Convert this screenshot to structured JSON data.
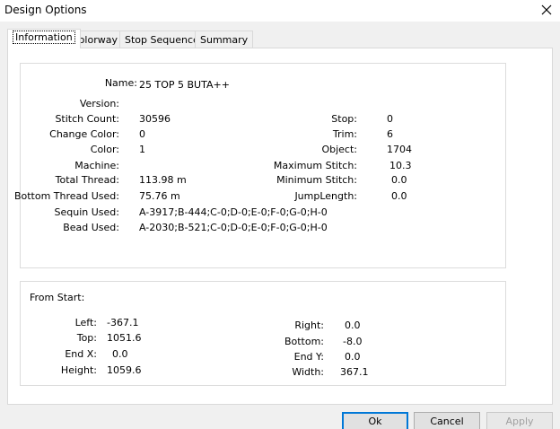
{
  "window": {
    "title": "Design Options"
  },
  "tabs": [
    "Information",
    "Colorway",
    "Stop Sequence",
    "Summary"
  ],
  "info": {
    "name_label": "Name:",
    "name_value": "25 TOP 5 BUTA++",
    "version_label": "Version:",
    "version_value": "",
    "stitch_count_label": "Stitch Count:",
    "stitch_count_value": "30596",
    "change_color_label": "Change Color:",
    "change_color_value": "0",
    "color_label": "Color:",
    "color_value": "1",
    "machine_label": "Machine:",
    "machine_value": "",
    "total_thread_label": "Total Thread:",
    "total_thread_value": "113.98 m",
    "bottom_thread_label": "Bottom Thread Used:",
    "bottom_thread_value": "75.76 m",
    "sequin_label": "Sequin Used:",
    "sequin_value": "A-3917;B-444;C-0;D-0;E-0;F-0;G-0;H-0",
    "bead_label": "Bead Used:",
    "bead_value": "A-2030;B-521;C-0;D-0;E-0;F-0;G-0;H-0",
    "stop_label": "Stop:",
    "stop_value": "0",
    "trim_label": "Trim:",
    "trim_value": "6",
    "object_label": "Object:",
    "object_value": "1704",
    "max_stitch_label": "Maximum Stitch:",
    "max_stitch_value": "10.3",
    "min_stitch_label": "Minimum Stitch:",
    "min_stitch_value": "0.0",
    "jump_length_label": "JumpLength:",
    "jump_length_value": "0.0"
  },
  "from_start": {
    "heading": "From Start:",
    "left_label": "Left:",
    "left_value": "-367.1",
    "top_label": "Top:",
    "top_value": "1051.6",
    "endx_label": "End X:",
    "endx_value": "0.0",
    "height_label": "Height:",
    "height_value": "1059.6",
    "right_label": "Right:",
    "right_value": "0.0",
    "bottom_label": "Bottom:",
    "bottom_value": "-8.0",
    "endy_label": "End Y:",
    "endy_value": "0.0",
    "width_label": "Width:",
    "width_value": "367.1"
  },
  "buttons": {
    "ok": "Ok",
    "cancel": "Cancel",
    "apply": "Apply"
  },
  "icons": {
    "close": "close-icon"
  },
  "colors": {
    "default_button_border": "#0078d7",
    "disabled_text": "#a0a0a0"
  }
}
